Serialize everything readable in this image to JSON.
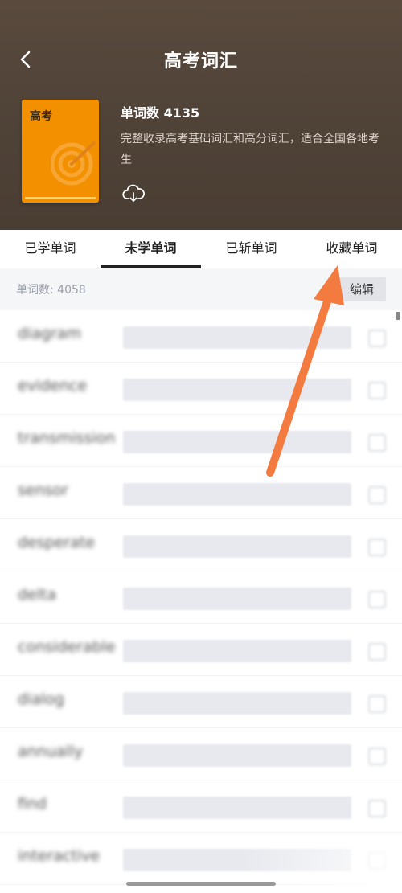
{
  "header": {
    "title": "高考词汇",
    "cover_label": "高考",
    "word_count": "单词数 4135",
    "description": "完整收录高考基础词汇和高分词汇，适合全国各地考生"
  },
  "tabs": [
    {
      "label": "已学单词"
    },
    {
      "label": "未学单词"
    },
    {
      "label": "已斩单词"
    },
    {
      "label": "收藏单词"
    }
  ],
  "subbar": {
    "count_label": "单词数: 4058",
    "edit_label": "编辑"
  },
  "words": [
    "diagram",
    "evidence",
    "transmission",
    "sensor",
    "desperate",
    "delta",
    "considerable",
    "dialog",
    "annually",
    "find",
    "interactive"
  ],
  "colors": {
    "header_bg": "#4f4237",
    "cover": "#f39000",
    "arrow": "#f47b40"
  },
  "icons": {
    "back": "chevron-left-icon",
    "download": "cloud-download-icon"
  }
}
